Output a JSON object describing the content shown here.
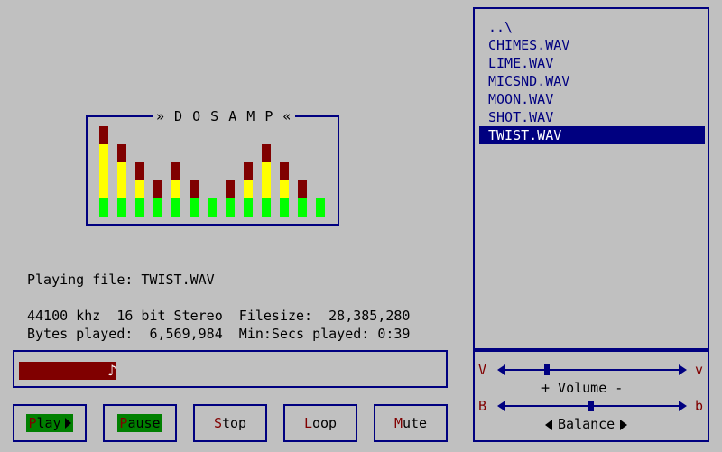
{
  "app": {
    "title": "» D O S A M P «"
  },
  "visualizer": {
    "levels": [
      5,
      4,
      3,
      2,
      3,
      2,
      1,
      2,
      3,
      4,
      3,
      2,
      1
    ],
    "max_level": 5,
    "colors": {
      "low": "#00ff00",
      "mid": "#ffff00",
      "high": "#800000"
    }
  },
  "info": {
    "playing_line": "Playing file: TWIST.WAV",
    "format_line": "44100 khz  16 bit Stereo  Filesize:  28,385,280",
    "played_line": "Bytes played:  6,569,984  Min:Secs played: 0:39"
  },
  "progress": {
    "fraction": 0.231,
    "icon": "music-note-icon"
  },
  "buttons": [
    {
      "hot": "P",
      "rest": "lay",
      "active": true,
      "arrow": true,
      "name": "play-button"
    },
    {
      "hot": "P",
      "rest": "ause",
      "active": true,
      "arrow": false,
      "name": "pause-button"
    },
    {
      "hot": "S",
      "rest": "top",
      "active": false,
      "arrow": false,
      "name": "stop-button"
    },
    {
      "hot": "L",
      "rest": "oop",
      "active": false,
      "arrow": false,
      "name": "loop-button"
    },
    {
      "hot": "M",
      "rest": "ute",
      "active": false,
      "arrow": false,
      "name": "mute-button"
    }
  ],
  "files": {
    "items": [
      "..\\",
      "CHIMES.WAV",
      "LIME.WAV",
      "MICSND.WAV",
      "MOON.WAV",
      "SHOT.WAV",
      "TWIST.WAV"
    ],
    "selected_index": 6
  },
  "controls": {
    "volume": {
      "left_key": "V",
      "right_key": "v",
      "label": "+ Volume -",
      "level": 0.25
    },
    "balance": {
      "left_key": "B",
      "right_key": "b",
      "label": "Balance",
      "level": 0.5
    }
  }
}
